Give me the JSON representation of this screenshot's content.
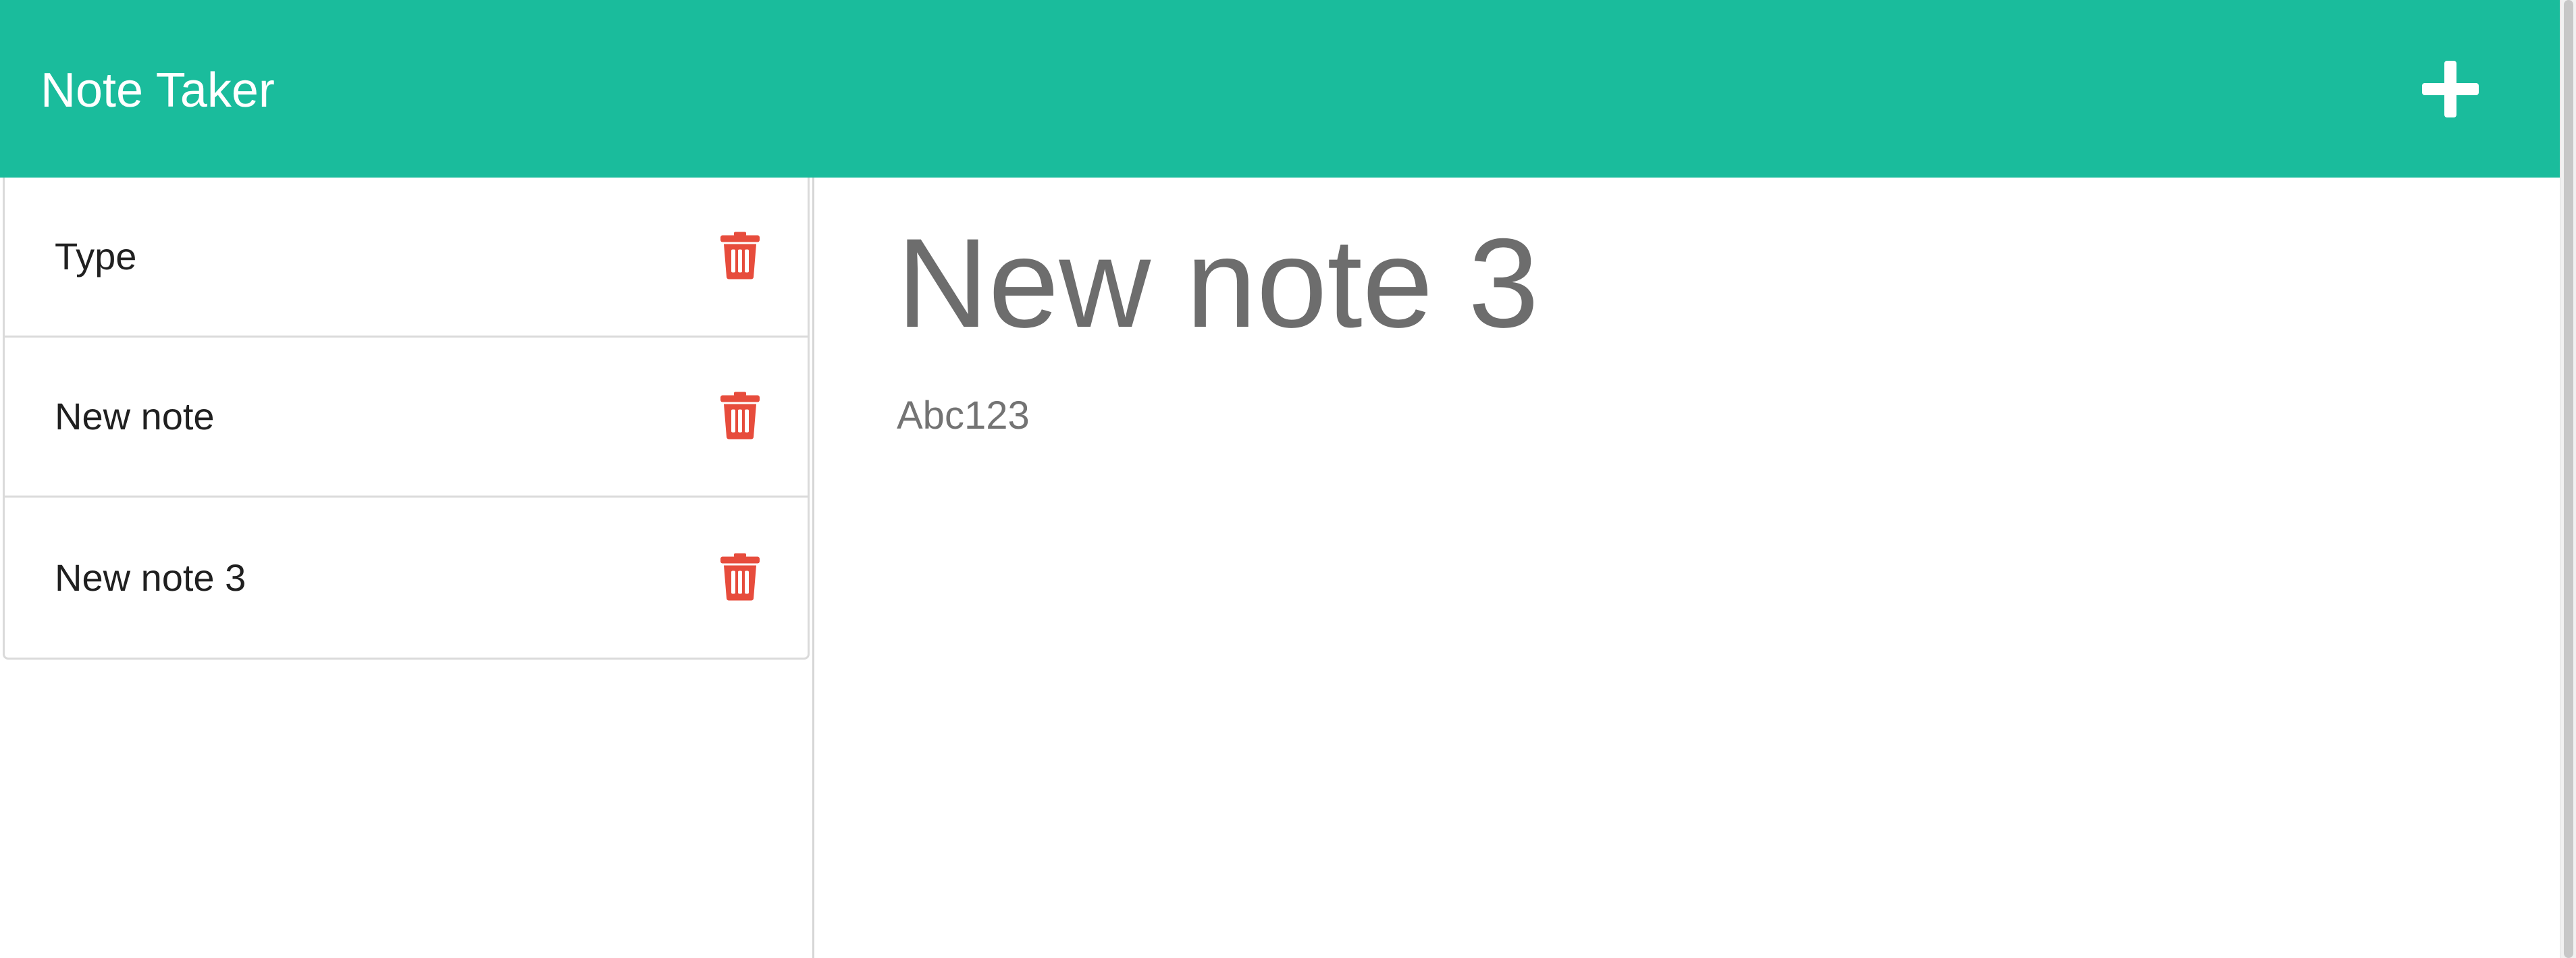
{
  "header": {
    "brand": "Note Taker",
    "add_icon": "plus-icon",
    "colors": {
      "background": "#1abc9c",
      "text": "#ffffff"
    }
  },
  "sidebar": {
    "notes": [
      {
        "title": "Type",
        "delete_icon": "trash-icon"
      },
      {
        "title": "New note",
        "delete_icon": "trash-icon"
      },
      {
        "title": "New note 3",
        "delete_icon": "trash-icon"
      }
    ],
    "delete_color": "#e74c3c"
  },
  "main": {
    "title": "New note 3",
    "body": "Abc123"
  }
}
